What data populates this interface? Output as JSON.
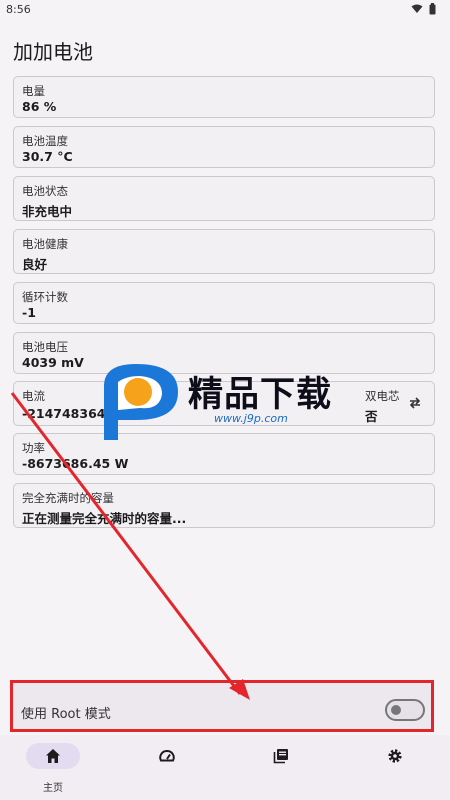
{
  "status": {
    "time": "8:56"
  },
  "app": {
    "title": "加加电池"
  },
  "cards": [
    {
      "label": "电量",
      "value": "86 %"
    },
    {
      "label": "电池温度",
      "value": "30.7 °C"
    },
    {
      "label": "电池状态",
      "value": "非充电中"
    },
    {
      "label": "电池健康",
      "value": "良好"
    },
    {
      "label": "循环计数",
      "value": "-1"
    },
    {
      "label": "电池电压",
      "value": "4039 mV"
    },
    {
      "label": "电流",
      "value": "-2147483648 mA",
      "dual_label": "双电芯",
      "dual_value": "否"
    },
    {
      "label": "功率",
      "value": "-8673686.45 W"
    },
    {
      "label": "完全充满时的容量",
      "value": "正在测量完全充满时的容量..."
    }
  ],
  "root_mode": {
    "label": "使用 Root 模式",
    "enabled": false
  },
  "nav": {
    "home_label": "主页"
  },
  "watermark": {
    "text": "精品下载",
    "url": "www.j9p.com"
  },
  "colors": {
    "accent": "#e3262b",
    "nav_active": "#e3dbf0",
    "card_border": "#ccc8cf"
  }
}
